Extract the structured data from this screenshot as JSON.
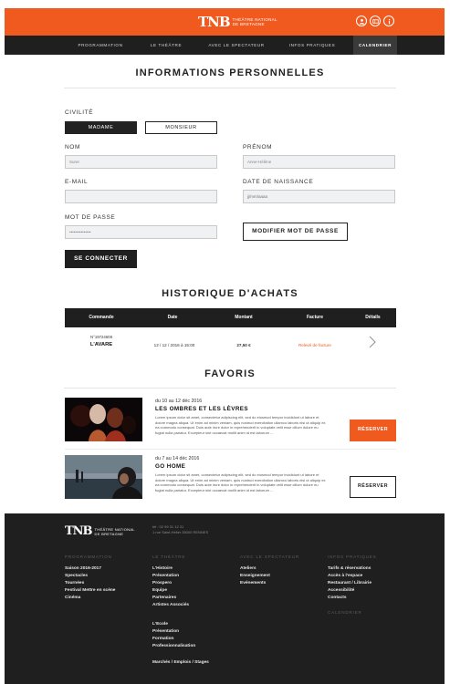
{
  "header": {
    "logo_mark": "TNB",
    "logo_line1": "THÉÂTRE NATIONAL",
    "logo_line2": "DE BRETAGNE",
    "icons": [
      "user-icon",
      "ticket-icon",
      "info-icon"
    ],
    "accent_color": "#f15a1f"
  },
  "nav": {
    "items": [
      "PROGRAMMATION",
      "LE THÉÂTRE",
      "AVEC LE SPECTATEUR",
      "INFOS PRATIQUES",
      "CALENDRIER"
    ],
    "active": "CALENDRIER"
  },
  "personal": {
    "title": "INFORMATIONS PERSONNELLES",
    "civilite_label": "CIVILITÉ",
    "madame": "MADAME",
    "monsieur": "MONSIEUR",
    "nom_label": "NOM",
    "nom_value": "Surer",
    "prenom_label": "PRÉNOM",
    "prenom_value": "Anne-Hélène",
    "email_label": "E-MAIL",
    "email_value": "",
    "birth_label": "DATE DE NAISSANCE",
    "birth_placeholder": "jj/mm/aaaa",
    "password_label": "MOT DE PASSE",
    "password_value": "•••••••••••••••",
    "modify_password": "MODIFIER MOT DE PASSE",
    "connect": "SE CONNECTER"
  },
  "history": {
    "title": "HISTORIQUE D'ACHATS",
    "columns": [
      "Commande",
      "Date",
      "Montant",
      "Facture",
      "Détails"
    ],
    "rows": [
      {
        "order_no": "N°19724608",
        "show": "L'AVARE",
        "date": "12 / 12 / 2016 à 15:00",
        "amount": "27,50 €",
        "invoice": "Relevé de facture"
      }
    ]
  },
  "favoris": {
    "title": "FAVORIS",
    "items": [
      {
        "date": "du 10 au 12 déc 2016",
        "title": "LES OMBRES ET LES LÈVRES",
        "desc": "Lorem ipsum dolor sit amet, consectetur adipiscing elit, sed do eiusmod tempor incididunt ut labore et dolore magna aliqua. Ut enim ad minim veniam, quis nostrud exercitation ullamco laboris nisi ut aliquip ex ea commodo consequat. Duis aute irure dolor in reprehenderit in voluptate velit esse cillum dolore eu fugiat nulla pariatur. Excepteur sint occaecat mollit anim id est laborum ...",
        "button": "RÉSERVER"
      },
      {
        "date": "du 7 au 14 déc 2016",
        "title": "GO HOME",
        "desc": "Lorem ipsum dolor sit amet, consectetur adipiscing elit, sed do eiusmod tempor incididunt ut labore et dolore magna aliqua. Ut enim ad minim veniam, quis nostrud exercitation ullamco laboris nisi ut aliquip ex ea commodo consequat. Duis aute irure dolor in reprehenderit in voluptate velit esse cillum dolore eu fugiat nulla pariatur. Excepteur sint occaecat mollit anim id est laborum ...",
        "button": "RÉSERVER"
      }
    ]
  },
  "footer": {
    "logo_mark": "TNB",
    "logo_line1": "THÉÂTRE NATIONAL",
    "logo_line2": "DE BRETAGNE",
    "phone": "tél : 02 99 31 12 31",
    "address": "1 rue Saint-Hélier 35000 RENNES",
    "col1_head": "PROGRAMMATION",
    "col1_links": [
      "Saison 2016-2017",
      "Spectacles",
      "Tournées",
      "Festival Mettre en scène",
      "Cinéma"
    ],
    "col2_head": "LE THÉÂTRE",
    "col2_links": [
      "L'Histoire",
      "Présentation",
      "Prospero",
      "Equipe",
      "Partenaires",
      "Artistes Associés"
    ],
    "col2_links_b": [
      "L'Ecole",
      "Présentation",
      "Formation",
      "Professionnalisation"
    ],
    "col2_link_c": "Marchés / Emplois / Stages",
    "col3_head": "AVEC LE SPECTATEUR",
    "col3_links": [
      "Ateliers",
      "Enseignement",
      "Evénements"
    ],
    "col4_head": "INFOS PRATIQUES",
    "col4_links": [
      "Tarifs & réservations",
      "Accès à l'espace",
      "Restaurant / Librairie",
      "Accessibilité",
      "Contacts"
    ],
    "col4_head2": "CALENDRIER"
  }
}
